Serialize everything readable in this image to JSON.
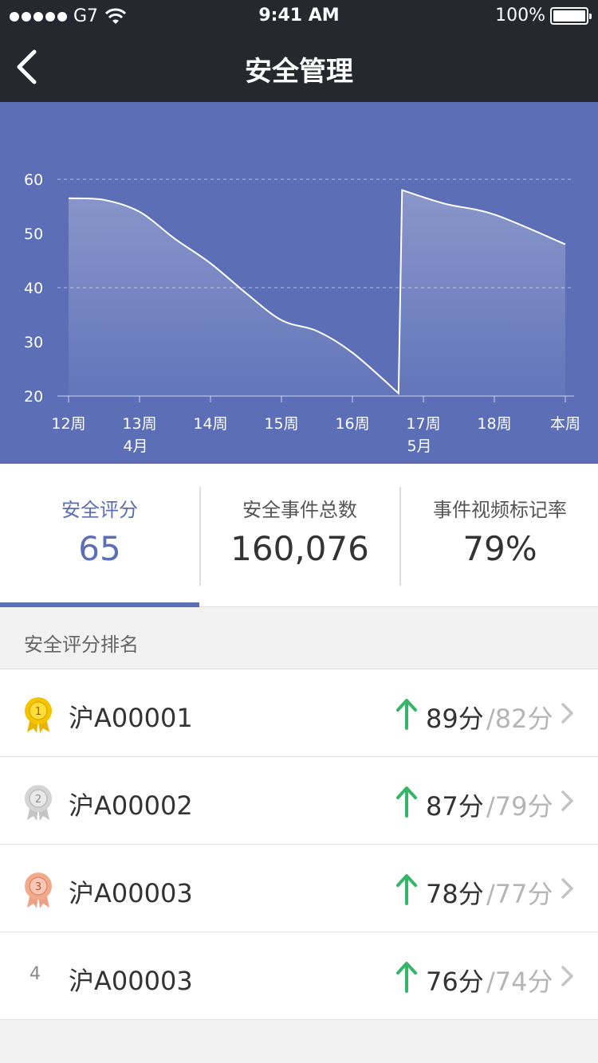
{
  "status_bar": {
    "carrier": "G7",
    "time": "9:41 AM",
    "battery": "100%"
  },
  "nav": {
    "title": "安全管理"
  },
  "chart_data": {
    "type": "area",
    "x_labels": [
      "12周",
      "13周",
      "14周",
      "15周",
      "16周",
      "17周",
      "18周",
      "本周"
    ],
    "x_sublabels": [
      {
        "label": "4月",
        "under": "13周"
      },
      {
        "label": "5月",
        "under": "17周"
      }
    ],
    "y_ticks": [
      60,
      50,
      40,
      30,
      20
    ],
    "ylim": [
      20,
      60
    ],
    "grid": "dashed at 40 and 60",
    "points": [
      {
        "x": 0,
        "y": 56.5
      },
      {
        "x": 0.5,
        "y": 56.2
      },
      {
        "x": 1,
        "y": 54
      },
      {
        "x": 1.5,
        "y": 49
      },
      {
        "x": 2,
        "y": 44.5
      },
      {
        "x": 2.5,
        "y": 39
      },
      {
        "x": 3,
        "y": 34
      },
      {
        "x": 3.5,
        "y": 32
      },
      {
        "x": 4,
        "y": 28
      },
      {
        "x": 4.65,
        "y": 20.5
      },
      {
        "x": 4.7,
        "y": 58
      },
      {
        "x": 5.3,
        "y": 55.5
      },
      {
        "x": 6,
        "y": 53.5
      },
      {
        "x": 7,
        "y": 48
      }
    ],
    "colors": {
      "background": "#5b6eb6",
      "line": "#ffffff",
      "fill": "rgba(255,255,255,0.22)"
    }
  },
  "stats": [
    {
      "label": "安全评分",
      "value": "65",
      "active": true
    },
    {
      "label": "安全事件总数",
      "value": "160,076",
      "active": false
    },
    {
      "label": "事件视频标记率",
      "value": "79%",
      "active": false
    }
  ],
  "ranking": {
    "title": "安全评分排名",
    "items": [
      {
        "rank": "1",
        "medal": "gold-medal-icon",
        "plate": "沪A00001",
        "score": "89分",
        "prev": "/82分",
        "trend": "up-arrow-icon"
      },
      {
        "rank": "2",
        "medal": "silver-medal-icon",
        "plate": "沪A00002",
        "score": "87分",
        "prev": "/79分",
        "trend": "up-arrow-icon"
      },
      {
        "rank": "3",
        "medal": "bronze-medal-icon",
        "plate": "沪A00003",
        "score": "78分",
        "prev": "/77分",
        "trend": "up-arrow-icon"
      },
      {
        "rank": "4",
        "medal": null,
        "plate": "沪A00003",
        "score": "76分",
        "prev": "/74分",
        "trend": "up-arrow-icon"
      }
    ]
  },
  "colors": {
    "accent": "#5b6eb6",
    "header": "#25292d",
    "trend_up": "#35b567",
    "gold": "#f5c400",
    "silver": "#cfcfcf",
    "bronze": "#f3a98c"
  }
}
